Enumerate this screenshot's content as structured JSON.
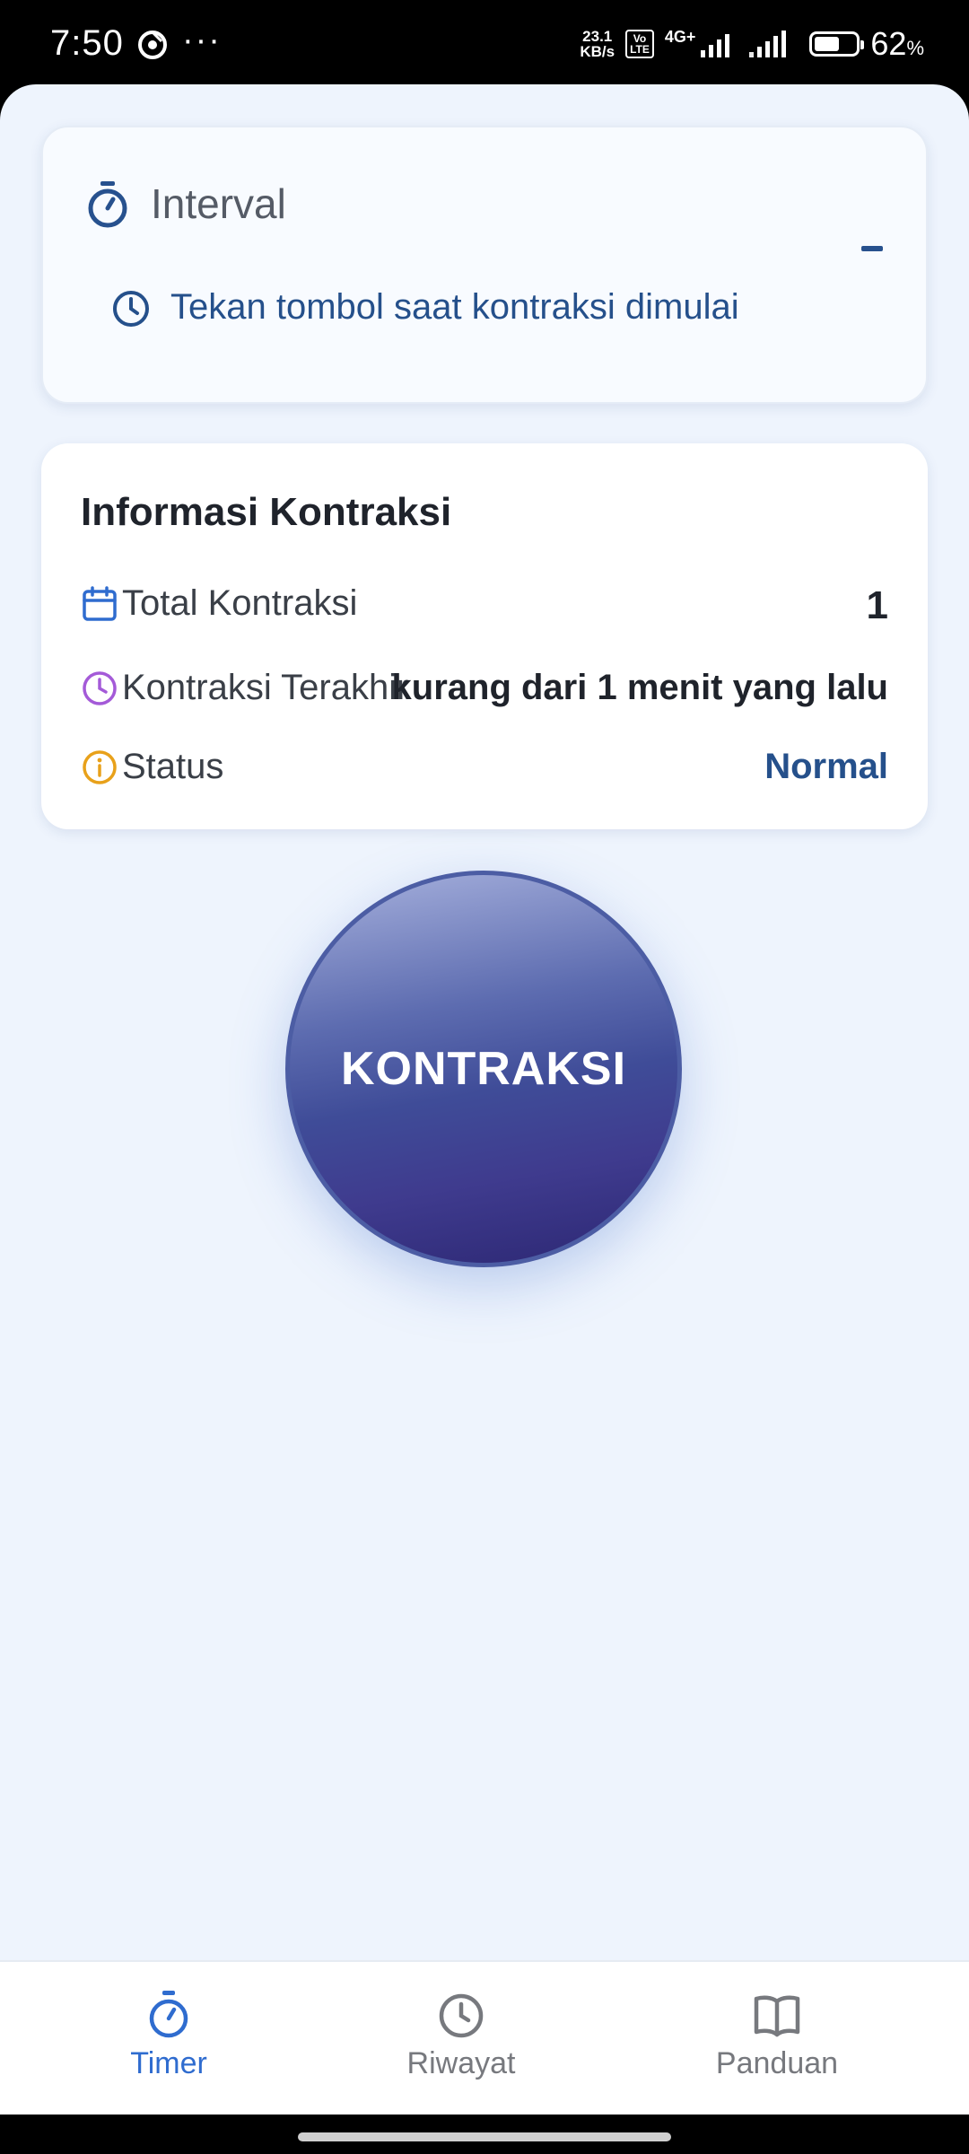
{
  "status_bar": {
    "time": "7:50",
    "more": "···",
    "net_speed_value": "23.1",
    "net_speed_unit": "KB/s",
    "volte_top": "Vo",
    "volte_bottom": "LTE",
    "network_type": "4G+",
    "battery_level": 0.62,
    "battery_text": "62",
    "battery_unit": "%"
  },
  "interval_card": {
    "title": "Interval",
    "hint": "Tekan tombol saat kontraksi dimulai"
  },
  "info_card": {
    "title": "Informasi Kontraksi",
    "rows": [
      {
        "label": "Total Kontraksi",
        "value": "1",
        "icon": "calendar-icon",
        "color": "#2f6ccf"
      },
      {
        "label": "Kontraksi Terakhir",
        "value": "kurang dari 1 menit yang lalu",
        "icon": "clock-icon",
        "color": "#a45ad8"
      },
      {
        "label": "Status",
        "value": "Normal",
        "icon": "info-icon",
        "color": "#e8a11a"
      }
    ]
  },
  "main_button": {
    "label": "KONTRAKSI"
  },
  "bottom_nav": {
    "items": [
      {
        "label": "Timer",
        "icon": "stopwatch-icon",
        "active": true
      },
      {
        "label": "Riwayat",
        "icon": "clock-icon",
        "active": false
      },
      {
        "label": "Panduan",
        "icon": "book-icon",
        "active": false
      }
    ]
  },
  "colors": {
    "accent": "#2f6ccf",
    "primary_dark": "#25508b",
    "background": "#eef4fd"
  }
}
